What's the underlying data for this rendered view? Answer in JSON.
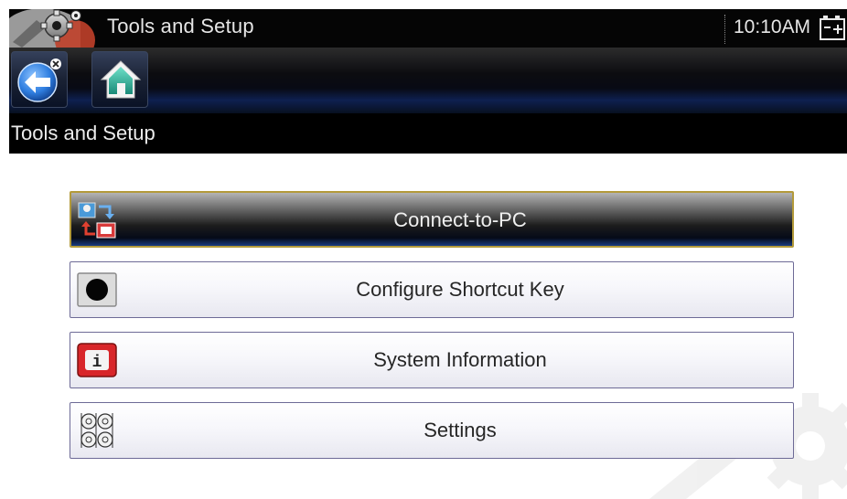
{
  "header": {
    "app_title": "Tools and Setup",
    "clock": "10:10AM",
    "app_icon": "gear-icon",
    "battery_icon": "battery-charging-icon"
  },
  "toolbar": {
    "back_icon": "back-arrow-icon",
    "home_icon": "home-icon"
  },
  "breadcrumb": {
    "text": "Tools and Setup"
  },
  "menu": {
    "items": [
      {
        "label": "Connect-to-PC",
        "icon": "connect-pc-icon",
        "selected": true
      },
      {
        "label": "Configure Shortcut Key",
        "icon": "record-dot-icon",
        "selected": false
      },
      {
        "label": "System Information",
        "icon": "info-icon",
        "selected": false
      },
      {
        "label": "Settings",
        "icon": "settings-icon",
        "selected": false
      }
    ]
  },
  "colors": {
    "selected_border": "#b39a3a",
    "item_border": "#6d6a96",
    "bar_background": "#000000"
  }
}
